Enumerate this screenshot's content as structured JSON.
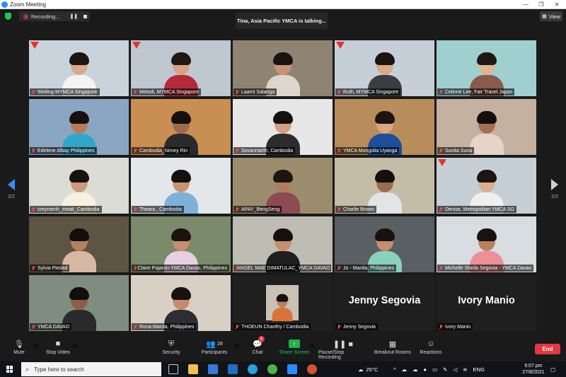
{
  "window": {
    "title": "Zoom Meeting",
    "minimize": "—",
    "maximize": "❐",
    "close": "✕"
  },
  "meeting": {
    "recording_label": "Recording...",
    "talking_banner": "Tina, Asia Pacific YMCA is talking...",
    "view_label": "View",
    "page_left": "2/2",
    "page_right": "2/2"
  },
  "participants": [
    {
      "name": "Weiling-MYMCA Singapore",
      "bg": "#c9d3db",
      "skin": "#d9a98a",
      "hair": "#1d1512",
      "shirt": "#f4f4f4",
      "logo": true
    },
    {
      "name": "Melodi, MYMCA Singapore",
      "bg": "#bfc8d0",
      "skin": "#d6a385",
      "hair": "#201713",
      "shirt": "#b52a3a",
      "logo": true
    },
    {
      "name": "Laarni Salanga",
      "bg": "#8f8372",
      "skin": "#c79577",
      "hair": "#1a1412",
      "shirt": "#ded6cc",
      "logo": false
    },
    {
      "name": "Ruth, MYMCA Singapore",
      "bg": "#c6cfd8",
      "skin": "#d8a889",
      "hair": "#1c1411",
      "shirt": "#3b3c44",
      "logo": true
    },
    {
      "name": "Celinne Lee, Fair Travel Japan",
      "bg": "#9fd0cf",
      "skin": "#e0b596",
      "hair": "#201814",
      "shirt": "#8a5a4a",
      "logo": false
    },
    {
      "name": "Edelene Albay Philippines",
      "bg": "#8aa6c2",
      "skin": "#b77b5b",
      "hair": "#16110f",
      "shirt": "#31a6c9",
      "logo": false
    },
    {
      "name": "Cambodia_Nimey Rin",
      "bg": "#c98e52",
      "skin": "#9e6a4c",
      "hair": "#15100d",
      "shirt": "#2a2a2a",
      "logo": false
    },
    {
      "name": "Sovannarith, Cambodia",
      "bg": "#e6e6e6",
      "skin": "#d3a080",
      "hair": "#131010",
      "shirt": "#2c2c2c",
      "logo": false
    },
    {
      "name": "YMCA Mongolia Uyanga",
      "bg": "#b98c5c",
      "skin": "#d9a686",
      "hair": "#1b1410",
      "shirt": "#1d4e9a",
      "logo": false
    },
    {
      "name": "Sunita Suna",
      "bg": "#c4b1a0",
      "skin": "#a56e52",
      "hair": "#140f0d",
      "shirt": "#e7d4c8",
      "logo": false
    },
    {
      "name": "sreymenh_meak_Cambodia",
      "bg": "#dcdcd6",
      "skin": "#cc987a",
      "hair": "#181210",
      "shirt": "#f6f0e0",
      "logo": false
    },
    {
      "name": "Theara , Cambodia",
      "bg": "#e3e7ea",
      "skin": "#c99272",
      "hair": "#131010",
      "shirt": "#7fb0d8",
      "logo": false
    },
    {
      "name": "APAY_BengSeng",
      "bg": "#9c8c6e",
      "skin": "#b07c5e",
      "hair": "#1c1512",
      "shirt": "#8c4a52",
      "logo": false
    },
    {
      "name": "Charlie Brown",
      "bg": "#c5bca8",
      "skin": "#9c6a4e",
      "hair": "#15100e",
      "shirt": "#e1e5e6",
      "logo": false
    },
    {
      "name": "Denise, Metropolitan YMCA SG",
      "bg": "#c7cfd6",
      "skin": "#dcae8f",
      "hair": "#1c1511",
      "shirt": "#efefef",
      "logo": true
    },
    {
      "name": "Sylvia Piedad",
      "bg": "#5d5443",
      "skin": "#b88060",
      "hair": "#140f0c",
      "shirt": "#d8b8a4",
      "logo": false
    },
    {
      "name": "Claire Pajaron-YMCA Davao, Philippines",
      "bg": "#7a8a6a",
      "skin": "#c49070",
      "hair": "#1a1310",
      "shirt": "#e6cfe0",
      "logo": false
    },
    {
      "name": "ANGEL MAE DIMATULAC_YMCA DAVAO",
      "bg": "#bfbcb3",
      "skin": "#c4906f",
      "hair": "#141010",
      "shirt": "#1e1e1e",
      "logo": false
    },
    {
      "name": "Jo - Manila, Philippines",
      "bg": "#5a5f63",
      "skin": "#c68e6c",
      "hair": "#171210",
      "shirt": "#8ad0be",
      "logo": false
    },
    {
      "name": "Michelle Sheila Segovia - YMCA Davao",
      "bg": "#d7dde0",
      "skin": "#b98060",
      "hair": "#181210",
      "shirt": "#ec8f96",
      "logo": false
    },
    {
      "name": "YMCA DAVAO",
      "bg": "#7f8c80",
      "skin": "#8e5e44",
      "hair": "#120e0c",
      "shirt": "#2a2a2a",
      "logo": false
    },
    {
      "name": "Rona-Manila, Philippines",
      "bg": "#d8d0c4",
      "skin": "#c48c6c",
      "hair": "#181310",
      "shirt": "#2d2d33",
      "logo": false
    },
    {
      "name": "THOEUN Chanthy / Cambodia",
      "bg": "#1f1f1f",
      "skin": "#b98060",
      "hair": "#141010",
      "shirt": "#d8733a",
      "logo": false,
      "small": true
    },
    {
      "name": "Jenny Segovia",
      "display": "Jenny Segovia",
      "camera_off": true
    },
    {
      "name": "Ivory Manio",
      "display": "Ivory Manio",
      "camera_off": true
    }
  ],
  "toolbar": {
    "mute": "Mute",
    "stop_video": "Stop Video",
    "security": "Security",
    "participants": "Participants",
    "participants_count": "28",
    "chat": "Chat",
    "chat_badge": "5",
    "share_screen": "Share Screen",
    "pause_recording": "Pause/Stop Recording",
    "breakout_rooms": "Breakout Rooms",
    "reactions": "Reactions",
    "end": "End"
  },
  "taskbar": {
    "search_placeholder": "Type here to search",
    "weather": "25°C",
    "language": "ENG",
    "time": "5:07 pm",
    "date": "27/8/2021"
  },
  "colors": {
    "zoom_blue": "#2d8cff",
    "end_red": "#e0393e",
    "share_green": "#23b14d",
    "mic_muted": "#ff4d4d"
  }
}
